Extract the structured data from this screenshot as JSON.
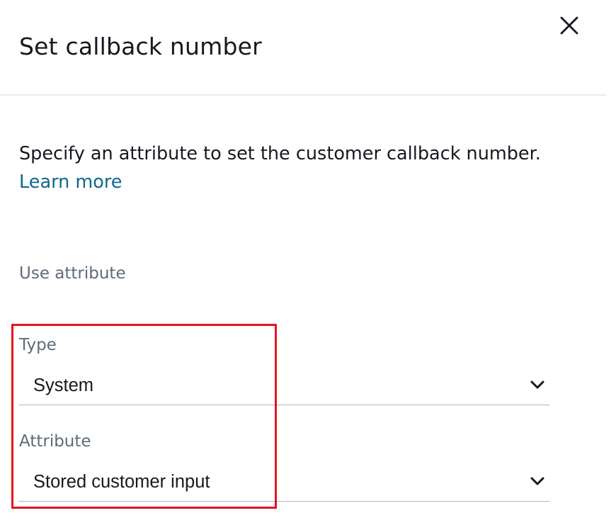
{
  "header": {
    "title": "Set callback number"
  },
  "description": {
    "text": "Specify an attribute to set the customer callback number.",
    "learn_more": "Learn more"
  },
  "section": {
    "label": "Use attribute"
  },
  "type_field": {
    "label": "Type",
    "value": "System"
  },
  "attribute_field": {
    "label": "Attribute",
    "value": "Stored customer input"
  },
  "icons": {
    "close": "close-icon",
    "chevron": "chevron-down-icon"
  },
  "colors": {
    "link": "#0b6990",
    "highlight": "#e8141b",
    "muted_label": "#5f6b7a"
  }
}
